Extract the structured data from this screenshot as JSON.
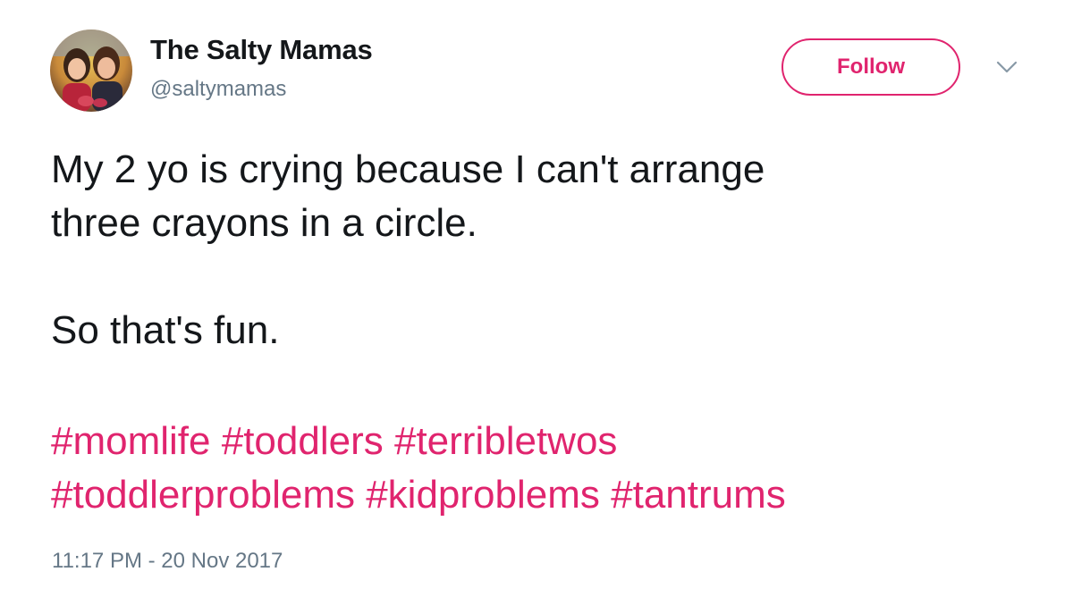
{
  "author": {
    "name": "The Salty Mamas",
    "handle": "@saltymamas"
  },
  "follow_button": {
    "label": "Follow"
  },
  "icons": {
    "avatar": "profile-photo",
    "menu": "chevron-down-icon"
  },
  "tweet": {
    "lines": [
      "My 2 yo is crying because I can't arrange",
      "three crayons in a circle.",
      "So that's fun."
    ],
    "hashtags": [
      [
        "#momlife",
        "#toddlers",
        "#terribletwos"
      ],
      [
        "#toddlerproblems",
        "#kidproblems",
        "#tantrums"
      ]
    ],
    "timestamp": "11:17 PM - 20 Nov 2017"
  },
  "colors": {
    "accent": "#e0246e",
    "text": "#14171a",
    "secondary": "#657786"
  }
}
